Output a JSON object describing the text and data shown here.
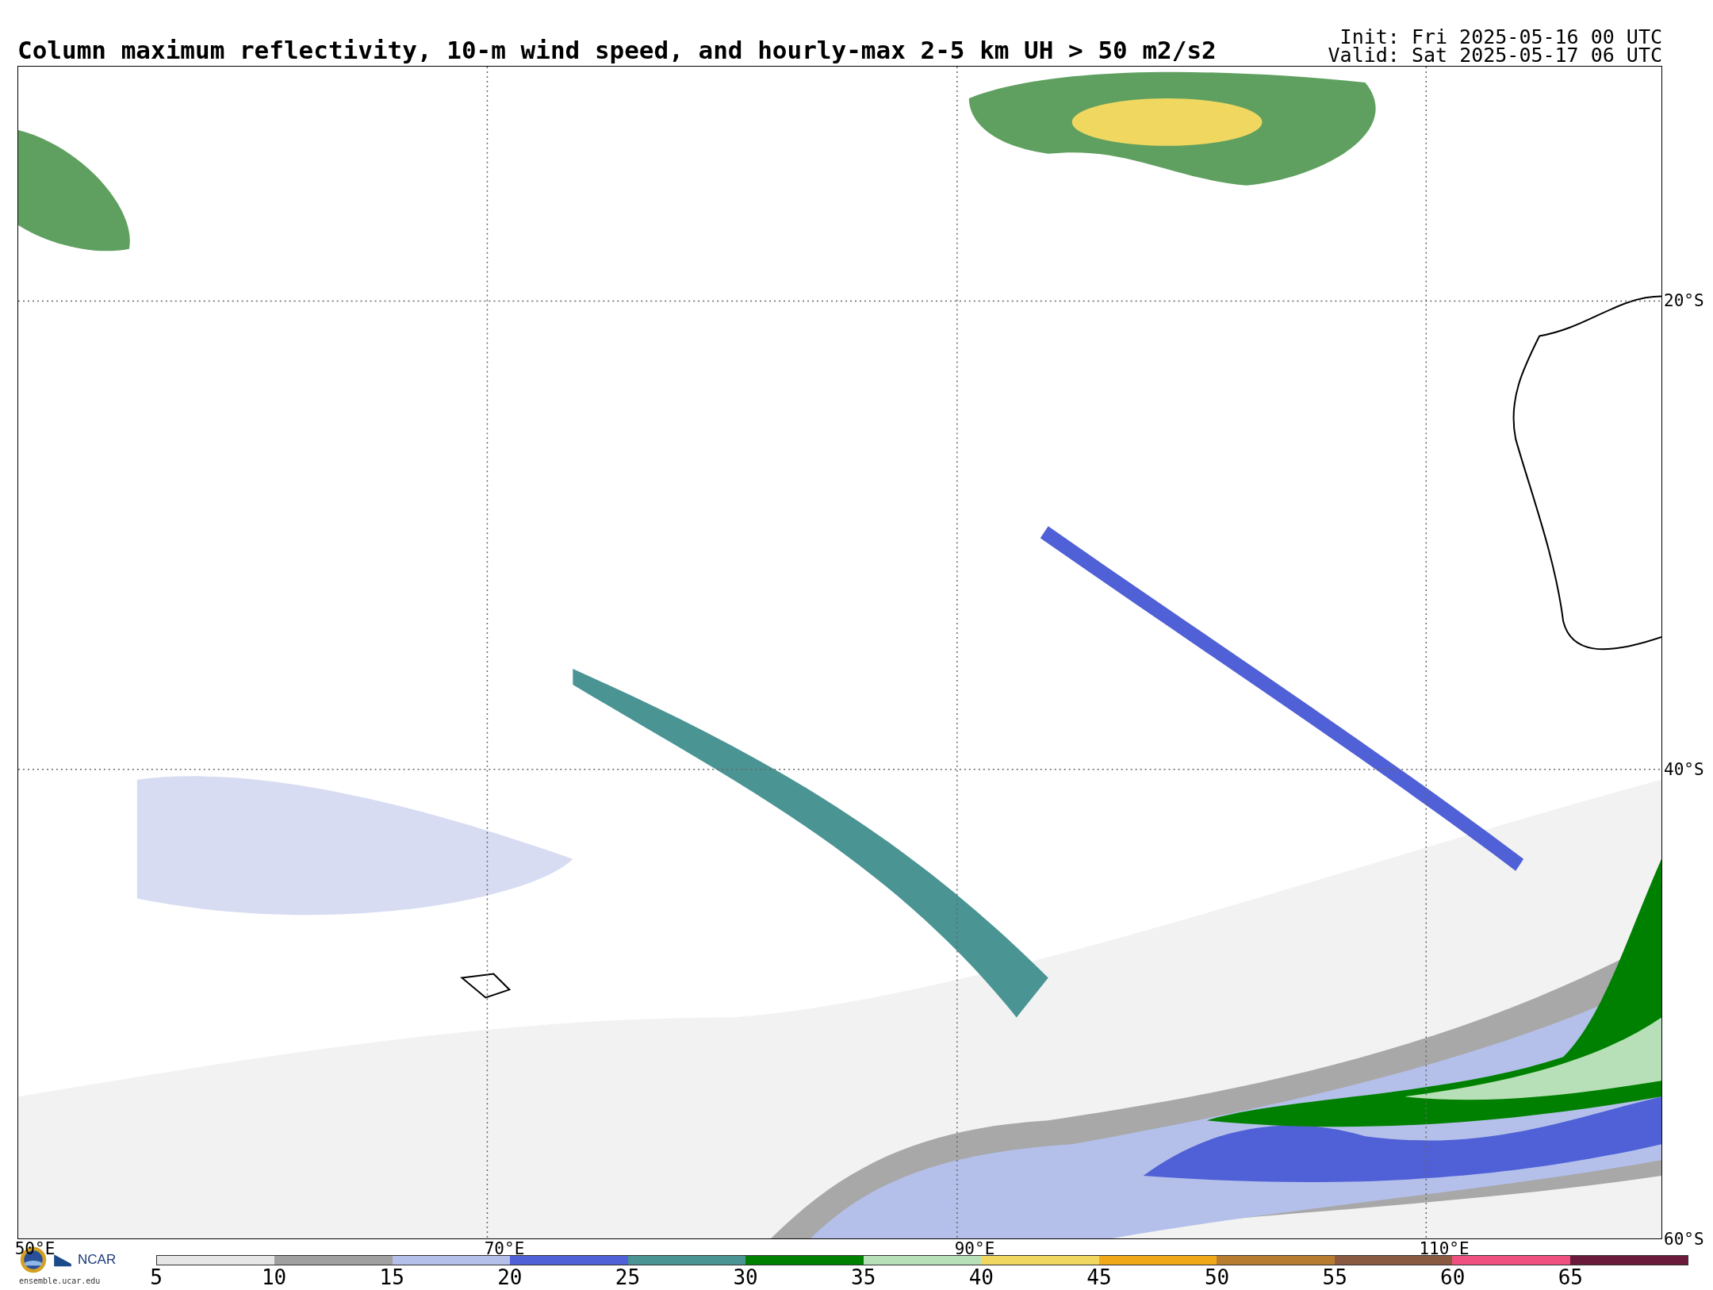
{
  "title": "Column maximum reflectivity, 10-m wind speed, and hourly-max 2-5 km UH > 50 m2/s2",
  "init": "Init: Fri 2025-05-16 00 UTC",
  "valid": "Valid: Sat 2025-05-17 06 UTC",
  "map": {
    "lat_labels": [
      "20°S",
      "40°S",
      "60°S"
    ],
    "lon_labels": [
      "50°E",
      "70°E",
      "90°E",
      "110°E"
    ]
  },
  "logo": {
    "name": "NCAR",
    "url": "ensemble.ucar.edu"
  },
  "colorbar": {
    "labels": [
      "5",
      "10",
      "15",
      "20",
      "25",
      "30",
      "35",
      "40",
      "45",
      "50",
      "55",
      "60",
      "65"
    ],
    "segments": [
      {
        "color": "#e6e6e6"
      },
      {
        "color": "#a0a0a0"
      },
      {
        "color": "#b4c0ea"
      },
      {
        "color": "#5060d6"
      },
      {
        "color": "#4a9494"
      },
      {
        "color": "#008000"
      },
      {
        "color": "#b8e0b8"
      },
      {
        "color": "#f0d860"
      },
      {
        "color": "#f0a818"
      },
      {
        "color": "#b87c30"
      },
      {
        "color": "#8a5a40"
      },
      {
        "color": "#f05080"
      },
      {
        "color": "#6a1a3a"
      }
    ]
  }
}
